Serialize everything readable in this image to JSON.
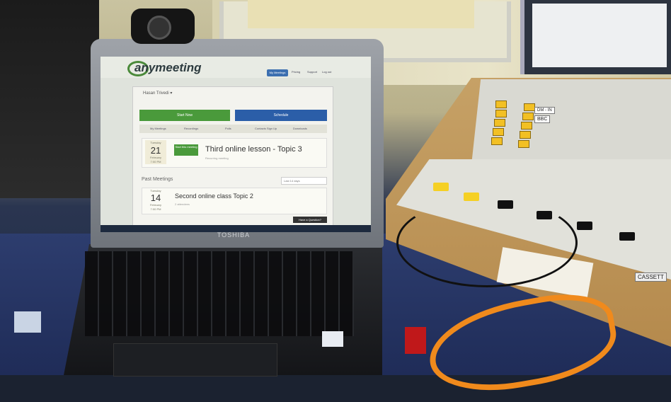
{
  "webpage": {
    "logo": "anymeeting",
    "nav": {
      "my_meetings": "My Meetings",
      "pricing": "Pricing",
      "support": "Support",
      "logout": "Log out"
    },
    "panel_title": "Hasan Trivedi ▾",
    "start_now": "Start Now",
    "schedule": "Schedule",
    "tabs": [
      "My Meetings",
      "Recordings",
      "Polls",
      "Contacts Sign Up",
      "Downloads"
    ],
    "upcoming": {
      "dow": "Tuesday",
      "day": "21",
      "month": "February",
      "time": "7:00 PM",
      "start_button": "Start this meeting",
      "title": "Third online lesson - Topic 3",
      "subtitle": "Recurring meeting"
    },
    "past_label": "Past Meetings",
    "past_filter": "Last 14 days",
    "past": {
      "dow": "Tuesday",
      "day": "14",
      "month": "February",
      "time": "7:00 PM",
      "title": "Second online class Topic 2",
      "subtitle": "2 attendees"
    },
    "have_question": "Have a Question?"
  },
  "laptop_brand": "TOSHIBA",
  "mixer_labels": {
    "bbc": "BBC",
    "dm": "DM - IN",
    "cassette": "CASSETT"
  },
  "colors": {
    "start_green": "#4a9a3b",
    "schedule_blue": "#2b5ea8",
    "lanyard_orange": "#f08a1c",
    "mixer_key_yellow": "#f2c024"
  }
}
